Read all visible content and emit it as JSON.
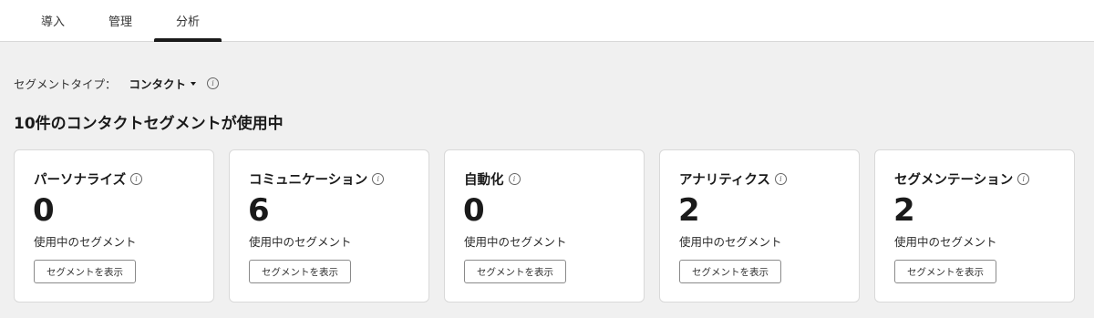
{
  "tabs": [
    {
      "label": "導入"
    },
    {
      "label": "管理"
    },
    {
      "label": "分析",
      "active": true
    }
  ],
  "segment_type": {
    "label": "セグメントタイプ：",
    "selected": "コンタクト"
  },
  "summary": "10件のコンタクトセグメントが使用中",
  "cards": [
    {
      "title": "パーソナライズ",
      "count": "0",
      "subtitle": "使用中のセグメント",
      "button": "セグメントを表示"
    },
    {
      "title": "コミュニケーション",
      "count": "6",
      "subtitle": "使用中のセグメント",
      "button": "セグメントを表示"
    },
    {
      "title": "自動化",
      "count": "0",
      "subtitle": "使用中のセグメント",
      "button": "セグメントを表示"
    },
    {
      "title": "アナリティクス",
      "count": "2",
      "subtitle": "使用中のセグメント",
      "button": "セグメントを表示"
    },
    {
      "title": "セグメンテーション",
      "count": "2",
      "subtitle": "使用中のセグメント",
      "button": "セグメントを表示"
    }
  ],
  "icons": {
    "info": "info-icon",
    "dropdown": "caret-down-icon"
  },
  "colors": {
    "page_background": "#f0f0f0",
    "card_background": "#ffffff",
    "text": "#1a1a1a",
    "active_tab_indicator": "#1a1a1a"
  }
}
